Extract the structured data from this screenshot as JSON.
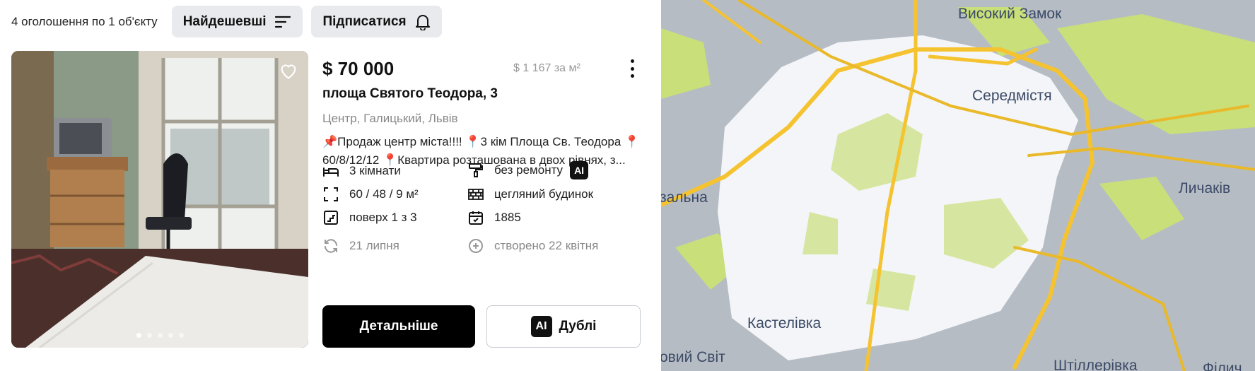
{
  "listings": {
    "count_text": "4 оголошення по 1 об'єкту"
  },
  "sort": {
    "label": "Найдешевші",
    "icon": "sort-lines-icon"
  },
  "subscribe": {
    "label": "Підписатися",
    "icon": "bell-icon"
  },
  "listing": {
    "price": "$ 70 000",
    "price_per_m2": "$ 1 167 за м²",
    "address": "площа Святого Теодора, 3",
    "location": "Центр, Галицький, Львів",
    "description_line1": "📌Продаж центр міста!!!! 📍3 кім Площа Св. Теодора 📍",
    "description_line2": "60/8/12/12 📍Квартира розташована в двох рівнях, з...",
    "features": {
      "rooms": "3 кімнати",
      "area": "60 / 48 / 9 м²",
      "floor": "поверх 1 з 3",
      "updated": "21 липня",
      "renovation": "без ремонту",
      "renovation_badge": "AI",
      "building": "цегляний будинок",
      "year": "1885",
      "created": "створено 22 квітня"
    },
    "photo_count": 5,
    "photo_active": 1,
    "details_button": "Детальніше",
    "duplicates_badge": "AI",
    "duplicates_button": "Дублі"
  },
  "map": {
    "labels": {
      "high_castle": "Високий Замок",
      "center": "Середмістя",
      "lychakiv": "Личаків",
      "kastelivka": "Кастелівка",
      "zaliznychna": "зальна",
      "novyi_svit": "овий Світ",
      "shtilerivka": "Штіллерівка",
      "filia": "Філич"
    },
    "colors": {
      "road": "#f5c330",
      "park": "#c9df7a",
      "built": "#aeb4bd",
      "center": "#ffffff"
    }
  }
}
